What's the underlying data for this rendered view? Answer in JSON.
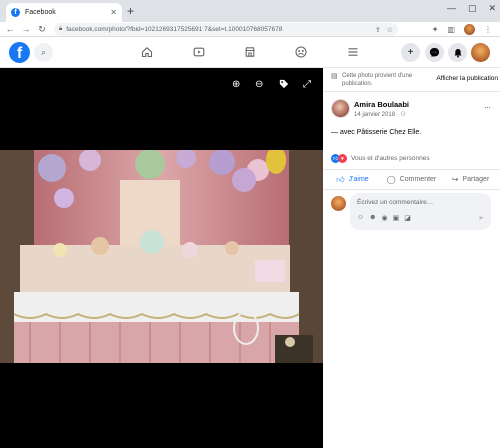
{
  "browser": {
    "tab_title": "Facebook",
    "tab_close": "✕",
    "new_tab": "+",
    "win_min": "—",
    "win_max": "▢",
    "win_close": "✕",
    "url": "facebook.com/photo/?fbid=1021269317525691 7&set=t.100010768057678"
  },
  "fb": {
    "logo": "f",
    "search_icon": "⌕"
  },
  "side": {
    "notice": "Cette photo provient d'une publication.",
    "view_post": "Afficher la publication",
    "author": "Amira Boulaabi",
    "date": "14 janvier 2018 · ⚇",
    "more": "···",
    "caption": "— avec Pâtisserie Chez Elle.",
    "reactions": "Vous et d'autres personnes",
    "like": "J'aime",
    "comment": "Commenter",
    "share": "Partager",
    "comment_placeholder": "Écrivez un commentaire…"
  },
  "colors": {
    "brand": "#1877f2",
    "love": "#f33e58"
  }
}
